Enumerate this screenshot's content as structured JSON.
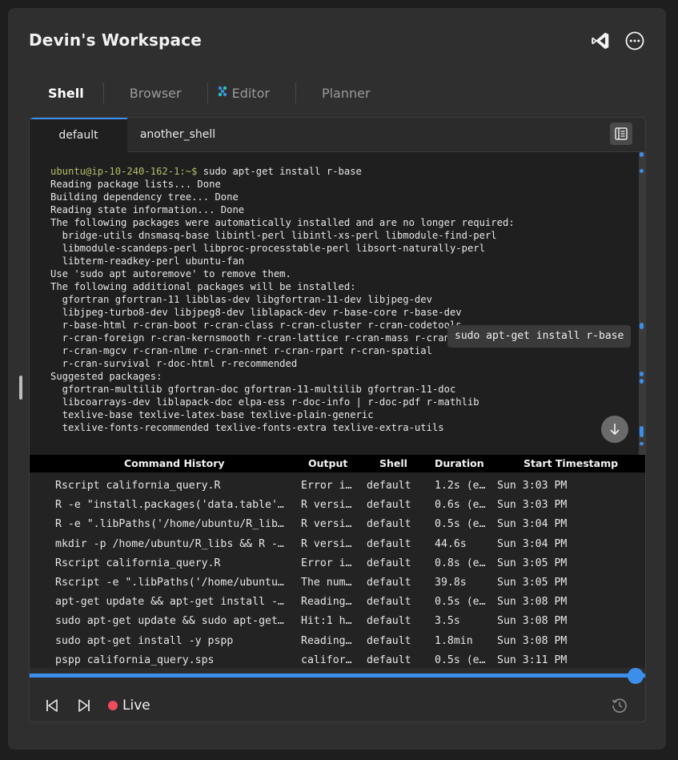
{
  "header": {
    "title": "Devin's Workspace",
    "icons": [
      "vscode-icon",
      "more-options-icon"
    ]
  },
  "tabs": [
    {
      "label": "Shell",
      "active": true
    },
    {
      "label": "Browser",
      "active": false
    },
    {
      "label": "Editor",
      "active": false,
      "icon": "editor-icon"
    },
    {
      "label": "Planner",
      "active": false
    }
  ],
  "shell_tabs": [
    {
      "label": "default",
      "active": true
    },
    {
      "label": "another_shell",
      "active": false
    }
  ],
  "terminal": {
    "prompt": "ubuntu@ip-10-240-162-1:~$",
    "command": " sudo apt-get install r-base",
    "output": [
      "Reading package lists... Done",
      "Building dependency tree... Done",
      "Reading state information... Done",
      "The following packages were automatically installed and are no longer required:",
      "  bridge-utils dnsmasq-base libintl-perl libintl-xs-perl libmodule-find-perl",
      "  libmodule-scandeps-perl libproc-processtable-perl libsort-naturally-perl",
      "  libterm-readkey-perl ubuntu-fan",
      "Use 'sudo apt autoremove' to remove them.",
      "The following additional packages will be installed:",
      "  gfortran gfortran-11 libblas-dev libgfortran-11-dev libjpeg-dev",
      "  libjpeg-turbo8-dev libjpeg8-dev liblapack-dev r-base-core r-base-dev",
      "  r-base-html r-cran-boot r-cran-class r-cran-cluster r-cran-codetools",
      "  r-cran-foreign r-cran-kernsmooth r-cran-lattice r-cran-mass r-cran-ma",
      "  r-cran-mgcv r-cran-nlme r-cran-nnet r-cran-rpart r-cran-spatial",
      "  r-cran-survival r-doc-html r-recommended",
      "Suggested packages:",
      "  gfortran-multilib gfortran-doc gfortran-11-multilib gfortran-11-doc",
      "  libcoarrays-dev liblapack-doc elpa-ess r-doc-info | r-doc-pdf r-mathlib",
      "  texlive-base texlive-latex-base texlive-plain-generic",
      "  texlive-fonts-recommended texlive-fonts-extra texlive-extra-utils"
    ],
    "tooltip": "sudo apt-get install r-base"
  },
  "history": {
    "columns": [
      "Command History",
      "Output",
      "Shell",
      "Duration",
      "Start Timestamp"
    ],
    "rows": [
      {
        "command": "Rscript california_query.R",
        "output": "Error i…",
        "shell": "default",
        "duration": "1.2s (e…",
        "timestamp": "Sun 3:03 PM"
      },
      {
        "command": "R -e \"install.packages('data.table'…",
        "output": "R versi…",
        "shell": "default",
        "duration": "0.6s (e…",
        "timestamp": "Sun 3:03 PM"
      },
      {
        "command": "R -e \".libPaths('/home/ubuntu/R_lib…",
        "output": "R versi…",
        "shell": "default",
        "duration": "0.5s (e…",
        "timestamp": "Sun 3:04 PM"
      },
      {
        "command": "mkdir -p /home/ubuntu/R_libs && R -…",
        "output": "R versi…",
        "shell": "default",
        "duration": "44.6s",
        "timestamp": "Sun 3:04 PM"
      },
      {
        "command": "Rscript california_query.R",
        "output": "Error i…",
        "shell": "default",
        "duration": "0.8s (e…",
        "timestamp": "Sun 3:05 PM"
      },
      {
        "command": "Rscript -e \".libPaths('/home/ubuntu…",
        "output": "The num…",
        "shell": "default",
        "duration": "39.8s",
        "timestamp": "Sun 3:05 PM"
      },
      {
        "command": "apt-get update && apt-get install -…",
        "output": "Reading…",
        "shell": "default",
        "duration": "0.5s (e…",
        "timestamp": "Sun 3:08 PM"
      },
      {
        "command": "sudo apt-get update && sudo apt-get…",
        "output": "Hit:1 h…",
        "shell": "default",
        "duration": "3.5s",
        "timestamp": "Sun 3:08 PM"
      },
      {
        "command": "sudo apt-get install -y pspp",
        "output": "Reading…",
        "shell": "default",
        "duration": "1.8min",
        "timestamp": "Sun 3:08 PM"
      },
      {
        "command": "pspp california_query.sps",
        "output": "califor…",
        "shell": "default",
        "duration": "0.5s (e…",
        "timestamp": "Sun 3:11 PM"
      }
    ]
  },
  "playback": {
    "live_label": "Live",
    "progress": 1.0,
    "colors": {
      "accent": "#3b8eea",
      "live": "#f04b5c"
    }
  }
}
